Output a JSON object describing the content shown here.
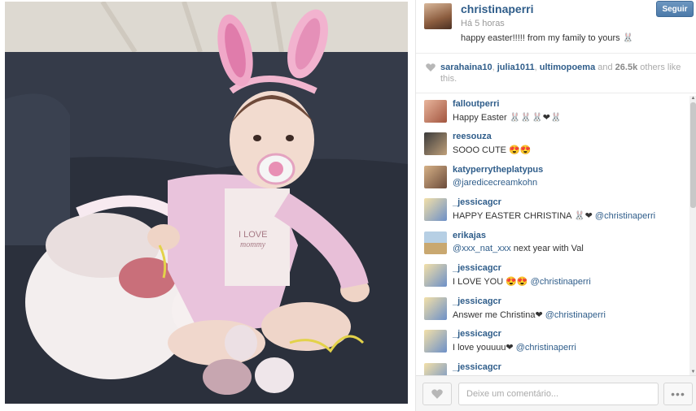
{
  "post": {
    "owner": "christinaperri",
    "time": "Há 5 horas",
    "caption": "happy easter!!!!! from my family to yours 🐰",
    "follow_label": "Seguir"
  },
  "photo": {
    "shirt_text_line1": "I LOVE",
    "shirt_text_line2": "mommy"
  },
  "likes": {
    "users": [
      "sarahaina10",
      "julia1011",
      "ultimopoema"
    ],
    "and_text": "and",
    "count": "26.5k",
    "others_text": "others like this."
  },
  "comments": [
    {
      "user": "falloutperri",
      "text": "Happy Easter 🐰🐰🐰❤🐰",
      "mention": ""
    },
    {
      "user": "reesouza",
      "text": "SOOO CUTE 😍😍",
      "mention": ""
    },
    {
      "user": "katyperrytheplatypus",
      "text": "",
      "mention": "@jaredicecreamkohn"
    },
    {
      "user": "_jessicagcr",
      "text": "HAPPY EASTER CHRISTINA 🐰❤ ",
      "mention": "@christinaperri"
    },
    {
      "user": "erikajas",
      "text": " next year with Val",
      "mention": "@xxx_nat_xxx"
    },
    {
      "user": "_jessicagcr",
      "text": "I LOVE YOU 😍😍 ",
      "mention": "@christinaperri"
    },
    {
      "user": "_jessicagcr",
      "text": "Answer me Christina❤ ",
      "mention": "@christinaperri"
    },
    {
      "user": "_jessicagcr",
      "text": "I love youuuu❤ ",
      "mention": "@christinaperri"
    },
    {
      "user": "_jessicagcr",
      "text": "",
      "mention": ""
    }
  ],
  "footer": {
    "comment_placeholder": "Deixe um comentário...",
    "more_label": "•••"
  },
  "colors": {
    "link": "#2f5d8a",
    "follow_button": "#4c7aa9"
  }
}
